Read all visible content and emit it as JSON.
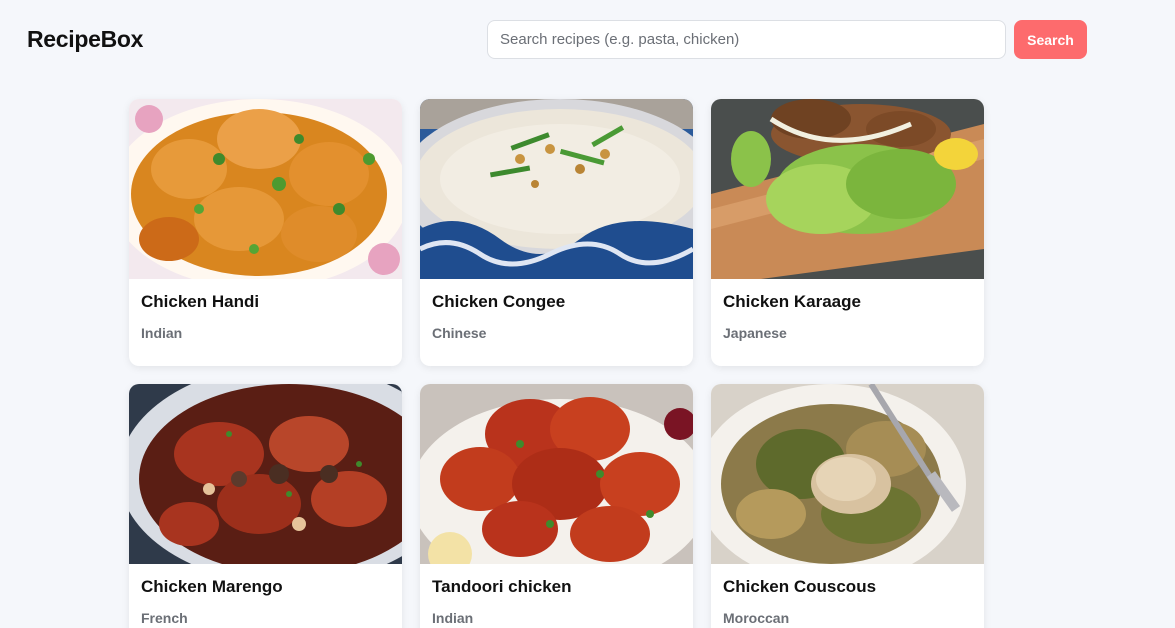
{
  "header": {
    "logo": "RecipeBox",
    "search_placeholder": "Search recipes (e.g. pasta, chicken)",
    "search_value": "",
    "search_button": "Search"
  },
  "colors": {
    "accent": "#fd6b6d",
    "background": "#f5f7fb",
    "muted_text": "#6b6f76"
  },
  "recipes": [
    {
      "title": "Chicken Handi",
      "cuisine": "Indian",
      "image": "chicken-handi-photo"
    },
    {
      "title": "Chicken Congee",
      "cuisine": "Chinese",
      "image": "chicken-congee-photo"
    },
    {
      "title": "Chicken Karaage",
      "cuisine": "Japanese",
      "image": "chicken-karaage-photo"
    },
    {
      "title": "Chicken Marengo",
      "cuisine": "French",
      "image": "chicken-marengo-photo"
    },
    {
      "title": "Tandoori chicken",
      "cuisine": "Indian",
      "image": "tandoori-chicken-photo"
    },
    {
      "title": "Chicken Couscous",
      "cuisine": "Moroccan",
      "image": "chicken-couscous-photo"
    }
  ]
}
